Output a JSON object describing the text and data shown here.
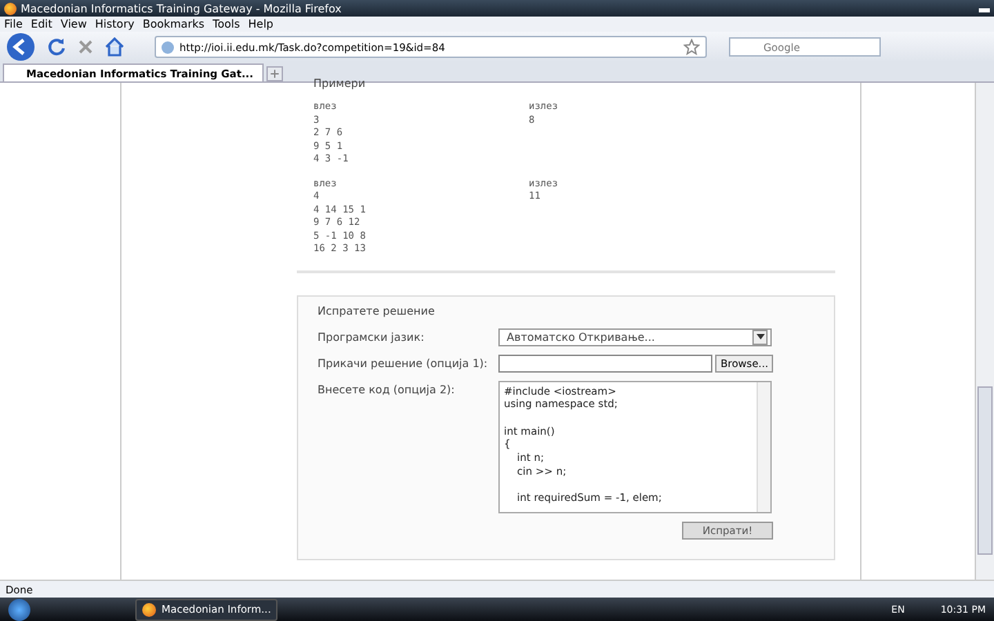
{
  "window": {
    "title": "Macedonian Informatics Training Gateway - Mozilla Firefox"
  },
  "menu": [
    "File",
    "Edit",
    "View",
    "History",
    "Bookmarks",
    "Tools",
    "Help"
  ],
  "address": {
    "value": "http://ioi.ii.edu.mk/Task.do?competition=19&id=84"
  },
  "search": {
    "placeholder": "Google"
  },
  "tabs": [
    {
      "label": "Macedonian Informatics Training Gat...",
      "selected": true
    }
  ],
  "examples": {
    "heading": "Примери",
    "items": [
      {
        "input_label": "влез",
        "output_label": "излез",
        "input": [
          "3",
          "2 7 6",
          "9 5 1",
          "4 3 -1"
        ],
        "output": [
          "8"
        ]
      },
      {
        "input_label": "влез",
        "output_label": "излез",
        "input": [
          "4",
          "4 14 15 1",
          "9 7 6 12",
          "5 -1 10 8",
          "16 2 3 13"
        ],
        "output": [
          "11"
        ]
      }
    ]
  },
  "form": {
    "legend": "Испратете решение",
    "language_label": "Програмски јазик:",
    "language_value": "Автоматско Откривање...",
    "upload_label": "Прикачи решение (опција 1):",
    "browse_button": "Browse...",
    "code_label": "Внесете код (опција 2):",
    "code_blocks": [
      [
        "#include <iostream>",
        "using namespace std;"
      ],
      [
        "int main()",
        "{",
        "    int n;",
        "    cin >> n;"
      ],
      [
        "    int requiredSum = -1, elem;"
      ]
    ],
    "submit_button": "Испрати!"
  },
  "status_bar": {
    "text": "Done"
  },
  "taskbar": {
    "window_button": "Macedonian Inform...",
    "language": "EN",
    "time": "10:31 PM"
  }
}
